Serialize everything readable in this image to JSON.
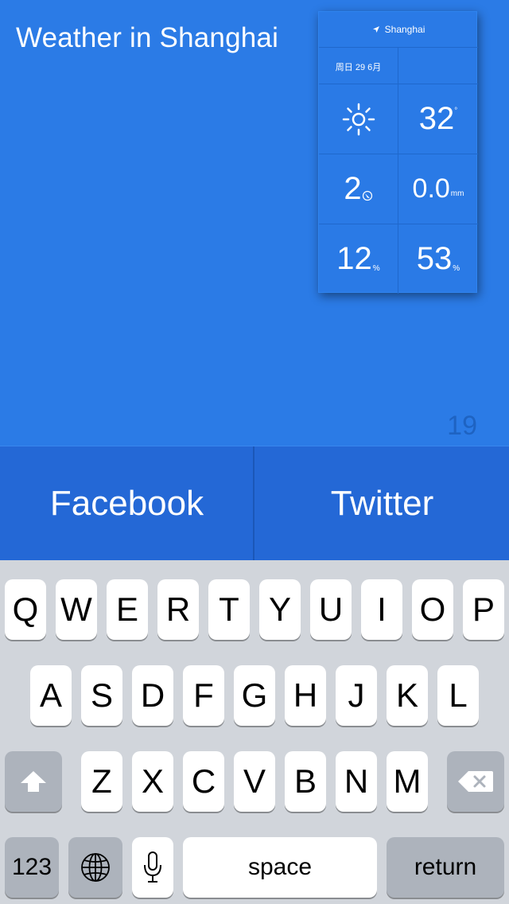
{
  "compose": {
    "text": "Weather in Shanghai",
    "char_count": "19"
  },
  "weather_card": {
    "location": "Shanghai",
    "date": "周日 29 6月",
    "temperature": "32",
    "temperature_unit": "°",
    "wind_speed": "2",
    "precipitation": "0.0",
    "precipitation_unit": "mm",
    "cloud_cover": "12",
    "cloud_unit": "%",
    "humidity": "53",
    "humidity_unit": "%"
  },
  "services": {
    "facebook_label": "Facebook",
    "twitter_label": "Twitter"
  },
  "keyboard": {
    "row1": [
      "Q",
      "W",
      "E",
      "R",
      "T",
      "Y",
      "U",
      "I",
      "O",
      "P"
    ],
    "row2": [
      "A",
      "S",
      "D",
      "F",
      "G",
      "H",
      "J",
      "K",
      "L"
    ],
    "row3": [
      "Z",
      "X",
      "C",
      "V",
      "B",
      "N",
      "M"
    ],
    "numbers_label": "123",
    "space_label": "space",
    "return_label": "return"
  }
}
